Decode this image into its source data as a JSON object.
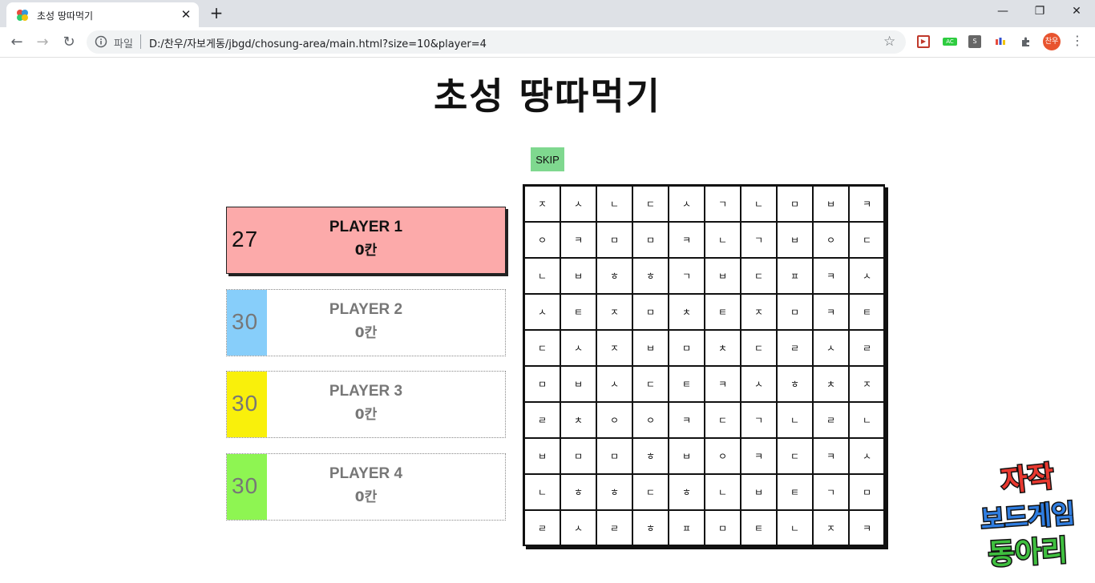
{
  "browser": {
    "tab_title": "초성 땅따먹기",
    "tab_close": "✕",
    "new_tab": "+",
    "window_buttons": [
      "—",
      "❐",
      "✕"
    ],
    "nav": {
      "back": "←",
      "forward": "→",
      "reload": "↻"
    },
    "scheme_label": "파일",
    "url": "D:/찬우/자보게동/jbgd/chosung-area/main.html?size=10&player=4",
    "bookmark_icon": "☆",
    "extensions": [
      {
        "name": "ext-red",
        "label": "▶",
        "color": "#c0392b"
      },
      {
        "name": "ext-green",
        "label": "AC",
        "color": "#2ecc40"
      },
      {
        "name": "ext-gray",
        "label": "S",
        "color": "#666666"
      },
      {
        "name": "ext-color",
        "label": "▮▮",
        "color": "#ffffff"
      },
      {
        "name": "ext-puzzle",
        "label": "✚",
        "color": "#ffffff"
      }
    ],
    "profile": "찬우",
    "menu": "⋮"
  },
  "page": {
    "title": "초성 땅따먹기",
    "skip_label": "SKIP",
    "players": [
      {
        "name": "PLAYER 1",
        "score": "0칸",
        "timer": "27",
        "color": "#fcaaaa",
        "active": true
      },
      {
        "name": "PLAYER 2",
        "score": "0칸",
        "timer": "30",
        "color": "#87cefa",
        "active": false
      },
      {
        "name": "PLAYER 3",
        "score": "0칸",
        "timer": "30",
        "color": "#f9f00b",
        "active": false
      },
      {
        "name": "PLAYER 4",
        "score": "0칸",
        "timer": "30",
        "color": "#8ef552",
        "active": false
      }
    ],
    "board": [
      [
        "ㅈ",
        "ㅅ",
        "ㄴ",
        "ㄷ",
        "ㅅ",
        "ㄱ",
        "ㄴ",
        "ㅁ",
        "ㅂ",
        "ㅋ"
      ],
      [
        "ㅇ",
        "ㅋ",
        "ㅁ",
        "ㅁ",
        "ㅋ",
        "ㄴ",
        "ㄱ",
        "ㅂ",
        "ㅇ",
        "ㄷ"
      ],
      [
        "ㄴ",
        "ㅂ",
        "ㅎ",
        "ㅎ",
        "ㄱ",
        "ㅂ",
        "ㄷ",
        "ㅍ",
        "ㅋ",
        "ㅅ"
      ],
      [
        "ㅅ",
        "ㅌ",
        "ㅈ",
        "ㅁ",
        "ㅊ",
        "ㅌ",
        "ㅈ",
        "ㅁ",
        "ㅋ",
        "ㅌ"
      ],
      [
        "ㄷ",
        "ㅅ",
        "ㅈ",
        "ㅂ",
        "ㅁ",
        "ㅊ",
        "ㄷ",
        "ㄹ",
        "ㅅ",
        "ㄹ"
      ],
      [
        "ㅁ",
        "ㅂ",
        "ㅅ",
        "ㄷ",
        "ㅌ",
        "ㅋ",
        "ㅅ",
        "ㅎ",
        "ㅊ",
        "ㅈ"
      ],
      [
        "ㄹ",
        "ㅊ",
        "ㅇ",
        "ㅇ",
        "ㅋ",
        "ㄷ",
        "ㄱ",
        "ㄴ",
        "ㄹ",
        "ㄴ"
      ],
      [
        "ㅂ",
        "ㅁ",
        "ㅁ",
        "ㅎ",
        "ㅂ",
        "ㅇ",
        "ㅋ",
        "ㄷ",
        "ㅋ",
        "ㅅ"
      ],
      [
        "ㄴ",
        "ㅎ",
        "ㅎ",
        "ㄷ",
        "ㅎ",
        "ㄴ",
        "ㅂ",
        "ㅌ",
        "ㄱ",
        "ㅁ"
      ],
      [
        "ㄹ",
        "ㅅ",
        "ㄹ",
        "ㅎ",
        "ㅍ",
        "ㅁ",
        "ㅌ",
        "ㄴ",
        "ㅈ",
        "ㅋ"
      ]
    ],
    "logo_lines": [
      "자작",
      "보드게임",
      "동아리"
    ]
  }
}
